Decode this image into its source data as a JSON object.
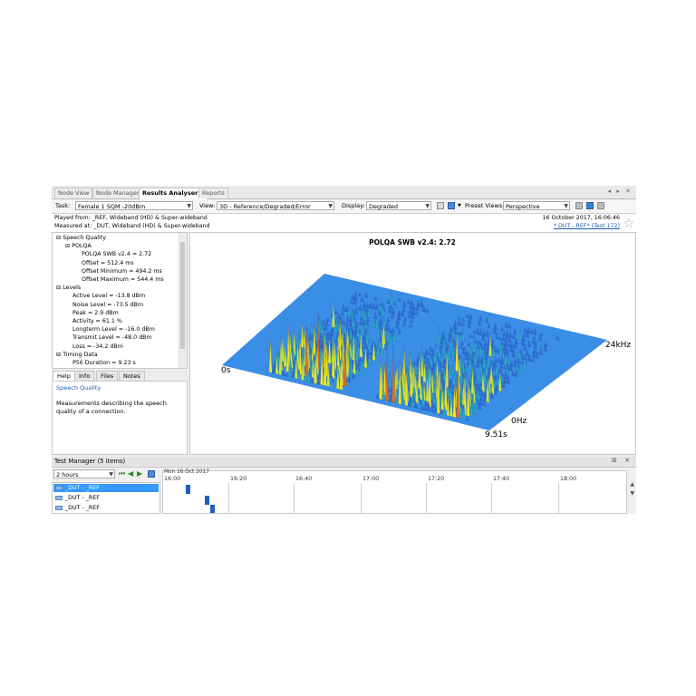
{
  "tabs": [
    "Node View",
    "Node Manager",
    "Results Analyser 1",
    "Reports"
  ],
  "active_tab": "Results Analyser 1",
  "tab_controls": "◂ ▸ ✕",
  "toolbar": {
    "task_label": "Task:",
    "task_value": "Female 1 SQM -20dBm",
    "view_label": "View:",
    "view_value": "3D - Reference/Degraded/Error",
    "display_label": "Display:",
    "display_value": "Degraded",
    "preset_label": "Preset Views:",
    "preset_value": "Perspective"
  },
  "info": {
    "played_from": "Played from: _REF, Wideband (HD) & Super-wideband",
    "measured_at": "Measured at: _DUT, Wideband (HD) & Super-wideband",
    "date": "16 October 2017, 16:06:46",
    "test_link": "* DUT - REF* (Test 172)"
  },
  "tree": [
    {
      "text": "Speech Quality",
      "level": 0,
      "toggle": "⊟"
    },
    {
      "text": "POLQA",
      "level": 1,
      "toggle": "⊟"
    },
    {
      "text": "POLQA SWB v2.4 = 2.72",
      "level": 2,
      "toggle": ""
    },
    {
      "text": "Offset = 512.4 ms",
      "level": 2,
      "toggle": ""
    },
    {
      "text": "Offset Minimum = 494.2 ms",
      "level": 2,
      "toggle": ""
    },
    {
      "text": "Offset Maximum = 544.4 ms",
      "level": 2,
      "toggle": ""
    },
    {
      "text": "Levels",
      "level": 0,
      "toggle": "⊟"
    },
    {
      "text": "Active Level = -13.8 dBm",
      "level": 1,
      "toggle": ""
    },
    {
      "text": "Noise Level = -73.5 dBm",
      "level": 1,
      "toggle": ""
    },
    {
      "text": "Peak = 2.9 dBm",
      "level": 1,
      "toggle": ""
    },
    {
      "text": "Activity = 61.1 %",
      "level": 1,
      "toggle": ""
    },
    {
      "text": "Longterm Level = -16.0 dBm",
      "level": 1,
      "toggle": ""
    },
    {
      "text": "Transmit Level = -48.0 dBm",
      "level": 1,
      "toggle": ""
    },
    {
      "text": "Loss = -34.2 dBm",
      "level": 1,
      "toggle": ""
    },
    {
      "text": "Timing Data",
      "level": 0,
      "toggle": "⊟"
    },
    {
      "text": "P56 Duration = 9.23 s",
      "level": 1,
      "toggle": ""
    }
  ],
  "help_tabs": [
    "Help",
    "Info",
    "Files",
    "Notes"
  ],
  "help": {
    "title": "Speech Quality",
    "description": "Measurements describing the speech quality of a connection."
  },
  "plot": {
    "title": "POLQA SWB v2.4: 2.72",
    "time_start_label": "0s",
    "time_end_label": "9.51s",
    "freq_low_label": "0Hz",
    "freq_high_label": "24kHz",
    "colors": {
      "base": "#3a8ee6",
      "low": "#2f6fd6",
      "mid": "#2ea9c6",
      "high": "#cde93a",
      "peak": "#f6e61a",
      "tip": "#e66a1a"
    }
  },
  "test_manager": {
    "title": "Test Manager (5 items)",
    "pin_controls": "⊞ ✕",
    "range_value": "2 hours",
    "date_label": "Mon 16 Oct 2017",
    "hours": [
      "16:00",
      "16:20",
      "16:40",
      "17:00",
      "17:20",
      "17:40",
      "18:00"
    ],
    "rows": [
      "_DUT - _REF",
      "_DUT - _REF",
      "_DUT - _REF"
    ]
  }
}
